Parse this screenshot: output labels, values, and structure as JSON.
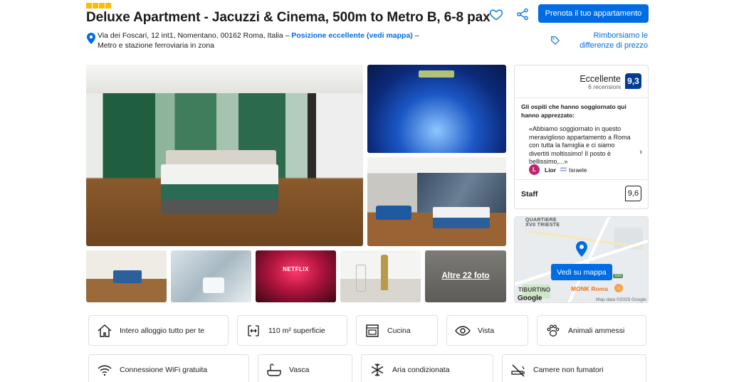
{
  "property": {
    "stars": 4,
    "title": "Deluxe Apartment - Jacuzzi & Cinema, 500m to Metro B, 6-8 pax",
    "address_text": "Via dei Foscari, 12 int1, Nomentano, 00162 Roma, Italia – ",
    "address_link": "Posizione eccellente (vedi mappa)",
    "address_tail": " –",
    "address_line2": "Metro e stazione ferroviaria in zona"
  },
  "header": {
    "book_label": "Prenota il tuo appartamento",
    "refund_label": "Rimborsiamo le differenze di prezzo"
  },
  "gallery": {
    "netflix_text": "NETFLIX",
    "more_photos_label": "Altre 22 foto"
  },
  "reviews": {
    "label": "Eccellente",
    "count": "6 recensioni",
    "score": "9,3",
    "intro": "Gli ospiti che hanno soggiornato qui hanno apprezzato:",
    "quote": "«Abbiamo soggiornato in questo meraviglioso appartamento a Roma con tutta la famiglia e ci siamo divertiti moltissimo! Il posto è bellissimo,...»",
    "reviewer_initial": "L",
    "reviewer_name": "Lior",
    "reviewer_country": "Israele",
    "staff_label": "Staff",
    "staff_score": "9,6"
  },
  "map": {
    "district_line1": "QUARTIERE",
    "district_line2": "XVII TRIESTE",
    "button_label": "Vedi su mappa",
    "area_label": "TIBURTINO",
    "poi_label": "MONK Roma",
    "road_label": "SS5",
    "google_label": "Google",
    "attribution": "Map data ©2025 Google"
  },
  "facilities": [
    {
      "label": "Intero alloggio tutto per te",
      "icon": "house-icon"
    },
    {
      "label": "110 m² superficie",
      "icon": "area-icon"
    },
    {
      "label": "Cucina",
      "icon": "oven-icon"
    },
    {
      "label": "Vista",
      "icon": "eye-icon"
    },
    {
      "label": "Animali ammessi",
      "icon": "paw-icon"
    },
    {
      "label": "Connessione WiFi gratuita",
      "icon": "wifi-icon"
    },
    {
      "label": "Vasca",
      "icon": "bathtub-icon"
    },
    {
      "label": "Aria condizionata",
      "icon": "snowflake-icon"
    },
    {
      "label": "Camere non fumatori",
      "icon": "no-smoking-icon"
    }
  ],
  "colors": {
    "accent": "#006ce4",
    "score_bg": "#003b95",
    "star": "#febb02"
  }
}
